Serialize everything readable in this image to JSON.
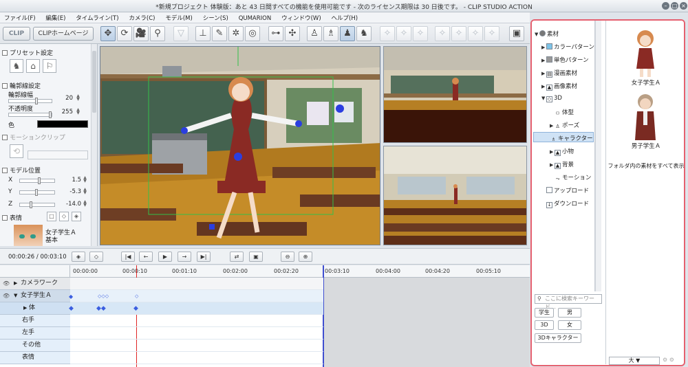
{
  "window": {
    "title": "*新規プロジェクト 体験版：あと 43 日間すべての機能を使用可能です - 次のライセンス期限は 30 日後です。 - CLIP STUDIO ACTION"
  },
  "menu": [
    "ファイル(F)",
    "編集(E)",
    "タイムライン(T)",
    "カメラ(C)",
    "モデル(M)",
    "シーン(S)",
    "QUMARION",
    "ウィンドウ(W)",
    "ヘルプ(H)"
  ],
  "toolbar": {
    "clip_label": "CLIP",
    "home_label": "CLIPホームページ"
  },
  "left_panel": {
    "preset": "プリセット設定",
    "outline": "輪郭線設定",
    "outline_width_label": "輪郭線幅",
    "outline_width": "20",
    "opacity_label": "不透明度",
    "opacity": "255",
    "color_label": "色",
    "motion_clip": "モーションクリップ",
    "model_pos": "モデル位置",
    "x_label": "X",
    "x": "1.5",
    "y_label": "Y",
    "y": "-5.3",
    "z_label": "Z",
    "z": "-14.0",
    "expression": "表情",
    "model_name": "女子学生Ａ",
    "model_sub": "基本"
  },
  "transport": {
    "time": "00:00:26 / 00:03:10"
  },
  "timeline": {
    "ruler": [
      "00:00:00",
      "00:00:10",
      "00:01:10",
      "00:02:00",
      "00:02:20",
      "00:03:10",
      "00:04:00",
      "00:04:20",
      "00:05:10"
    ],
    "tracks": [
      "カメラワーク",
      "女子学生Ａ",
      "体",
      "右手",
      "左手",
      "その他",
      "表情"
    ]
  },
  "materials": {
    "tree": [
      "素材",
      "カラーパターン",
      "単色パターン",
      "漫画素材",
      "画像素材",
      "3D",
      "体型",
      "ポーズ",
      "キャラクター",
      "小物",
      "背景",
      "モーション",
      "アップロード",
      "ダウンロード"
    ],
    "search_placeholder": "ここに検索キーワード…",
    "tags": [
      "学生",
      "男",
      "3D",
      "女",
      "3Dキャラクター"
    ],
    "items": [
      "女子学生Ａ",
      "男子学生Ａ"
    ],
    "show_all": "フォルダ内の素材をすべて表示",
    "size": "大"
  }
}
